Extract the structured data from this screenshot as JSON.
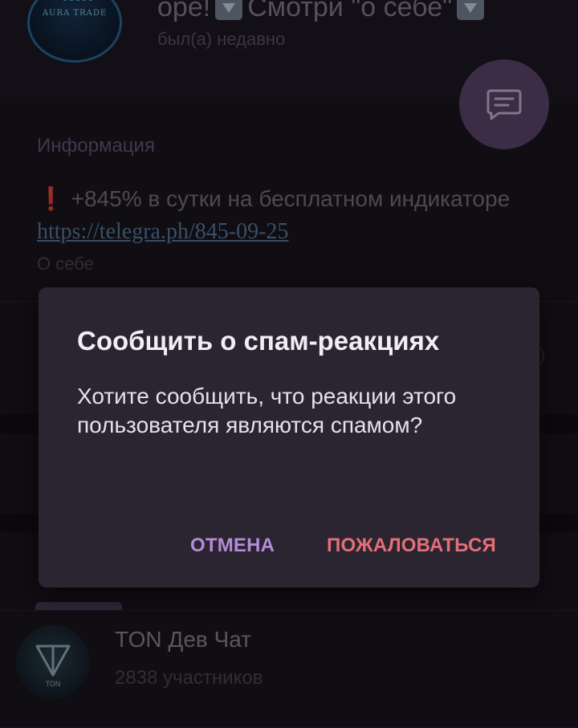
{
  "profile": {
    "avatar_logo_text": "AURA TRADE",
    "title_fragment_1": "ope!",
    "title_fragment_2": "Смотри \"о себе\"",
    "status": "был(а) недавно",
    "section_title": "Информация",
    "bio_text": "+845% в сутки на бесплатном индикаторе",
    "bio_link": "https://telegra.ph/845-09-25",
    "bio_caption": "О себе"
  },
  "dialog": {
    "title": "Сообщить о спам-реакциях",
    "body": "Хотите сообщить, что реакции этого пользователя являются спамом?",
    "cancel_label": "ОТМЕНА",
    "report_label": "ПОЖАЛОВАТЬСЯ"
  },
  "chat_item": {
    "name": "TON Дев Чат",
    "members": "2838 участников",
    "avatar_text": "TON"
  },
  "colors": {
    "background": "#1a1620",
    "dialog_bg": "#2b2532",
    "cancel": "#b58bd8",
    "report": "#e56f77",
    "fab": "#5e4a70"
  },
  "icons": [
    "arrow-down-emoji-icon",
    "chat-icon",
    "exclamation-icon"
  ]
}
